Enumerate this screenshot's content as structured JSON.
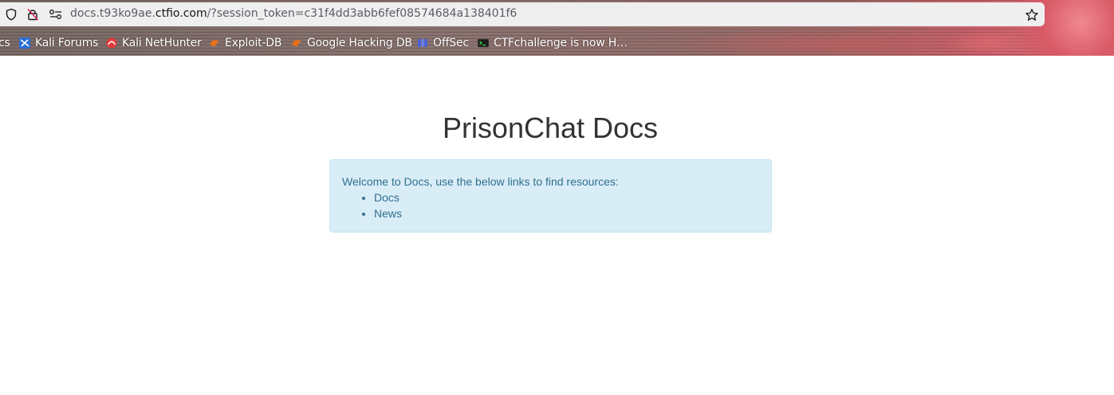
{
  "browser": {
    "url_host": "docs.t93ko9ae.ctfio.com",
    "url_path": "/?session_token=c31f4dd3abb6fef08574684a138401f6",
    "url_prefix": "docs.t93ko9ae.",
    "url_domain": "ctfio.com"
  },
  "bookmarks": [
    {
      "label": "cs",
      "icon": "kali-docs-icon"
    },
    {
      "label": "Kali Forums",
      "icon": "kali-forums-icon"
    },
    {
      "label": "Kali NetHunter",
      "icon": "kali-nethunter-icon"
    },
    {
      "label": "Exploit-DB",
      "icon": "exploit-db-icon"
    },
    {
      "label": "Google Hacking DB",
      "icon": "ghdb-icon"
    },
    {
      "label": "OffSec",
      "icon": "offsec-icon"
    },
    {
      "label": "CTFchallenge is now H…",
      "icon": "terminal-icon"
    }
  ],
  "page": {
    "title": "PrisonChat Docs",
    "welcome_text": "Welcome to Docs, use the below links to find resources:",
    "links": [
      {
        "label": "Docs"
      },
      {
        "label": "News"
      }
    ]
  },
  "colors": {
    "alert_bg": "#d9edf7",
    "alert_border": "#bce8f1",
    "alert_text": "#31708f",
    "title_text": "#333333"
  }
}
